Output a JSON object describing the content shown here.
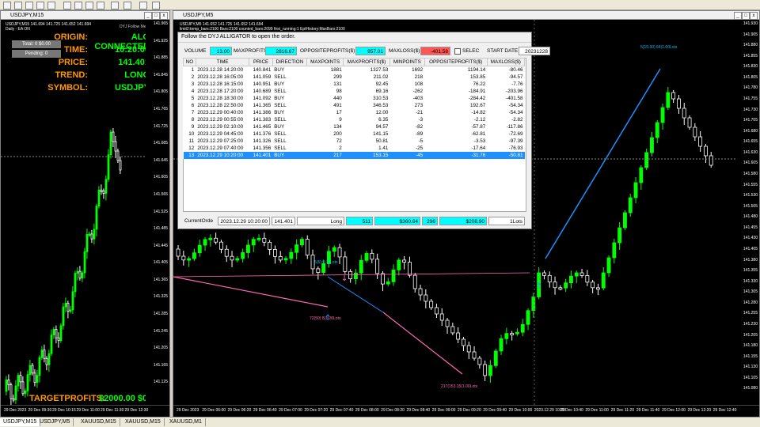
{
  "left_chart": {
    "title": "USDJPY,M15",
    "header_line": "USDJPY,M15  141.694 141.725 141.652 141.694",
    "ea_label": "DYJ Follow Me",
    "mode_label": "Daily - EA ON",
    "total_label": "Total: 0 $0.00",
    "pending_label": "Pending: 0",
    "info": {
      "origin_key": "ORIGIN:",
      "origin_val": "ALG CONNECTED",
      "time_key": "TIME:",
      "time_val": "10:20:00",
      "price_key": "PRICE:",
      "price_val": "141.401",
      "trend_key": "TREND:",
      "trend_val": "LONG",
      "symbol_key": "SYMBOL:",
      "symbol_val": "USDJPY"
    },
    "target_key": "TARGETPROFITS:",
    "target_val": "$2000.00 $0.00",
    "price_labels": [
      "141.965",
      "141.925",
      "141.885",
      "141.845",
      "141.805",
      "141.765",
      "141.725",
      "141.685",
      "141.645",
      "141.605",
      "141.565",
      "141.525",
      "141.485",
      "141.445",
      "141.405",
      "141.365",
      "141.325",
      "141.285",
      "141.245",
      "141.205",
      "141.165",
      "141.125"
    ],
    "current_price": "141.694",
    "time_labels": [
      "29 Dec 2023",
      "29 Dec 09:30",
      "29 Dec 10:15",
      "29 Dec 11:00",
      "29 Dec 11:30",
      "29 Dec 12:30"
    ]
  },
  "main_chart": {
    "title": "USDJPY,M5",
    "header_line": "USDJPY,M5  141.652 141.725 141.652 141.694",
    "sub_header": "limit2:temp_bars:2100 Bars:2100 counted_bars:2099 first_running:1 EptHistory:MaxBars:2100",
    "price_labels": [
      "141.930",
      "141.905",
      "141.880",
      "141.855",
      "141.830",
      "141.805",
      "141.780",
      "141.755",
      "141.730",
      "141.705",
      "141.680",
      "141.655",
      "141.630",
      "141.605",
      "141.580",
      "141.555",
      "141.530",
      "141.505",
      "141.480",
      "141.455",
      "141.430",
      "141.405",
      "141.380",
      "141.355",
      "141.330",
      "141.305",
      "141.280",
      "141.255",
      "141.230",
      "141.205",
      "141.180",
      "141.155",
      "141.130",
      "141.105",
      "141.080"
    ],
    "current_price": "141.694",
    "time_labels": [
      "29 Dec 2023",
      "29 Dec 06:00",
      "29 Dec 06:20",
      "29 Dec 06:40",
      "29 Dec 07:00",
      "29 Dec 07:20",
      "29 Dec 07:40",
      "29 Dec 08:00",
      "29 Dec 08:20",
      "29 Dec 08:40",
      "29 Dec 09:00",
      "29 Dec 09:20",
      "29 Dec 09:40",
      "29 Dec 10:00",
      "2023.12.29 10:20",
      "29 Dec 10:40",
      "29 Dec 11:00",
      "29 Dec 11:20",
      "29 Dec 11:40",
      "29 Dec 12:00",
      "29 Dec 12:20",
      "29 Dec 12:40"
    ],
    "annotations": {
      "top": "5(15:30) 64(1.00Lots",
      "mid": "5(5):9.00Lots",
      "left": "72(50) 8(1.00Lots",
      "bottom": "217(153.15(1.00Lots"
    }
  },
  "dialog": {
    "title": "Follow the DYJ ALLIGATOR to open the order.",
    "top": {
      "volume_label": "VOLUME",
      "volume_val": "13.00",
      "maxprofits_label": "MAXPROFITS",
      "maxprofits_val": "2816.67",
      "opposite_label": "OPPOSITEPROFITS($)",
      "opposite_val": "957.01",
      "maxloss_label": "MAXLOSS($)",
      "maxloss_val": "-401.58",
      "select_label": "SELEC",
      "startdate_label": "START DATE",
      "startdate_val": "20231228"
    },
    "columns": [
      "NO",
      "TIME",
      "PRICE",
      "DIRECTION",
      "MAXPOINTS",
      "MAXPROFITS($)",
      "MINPOINTS",
      "OPPOSITEPROFITS($)",
      "MAXLOSS($)"
    ],
    "rows": [
      [
        "1",
        "2023.12.28 14:20:00",
        "140.841",
        "BUY",
        "1881",
        "1327.53",
        "1692",
        "1194.14",
        "-80.46"
      ],
      [
        "2",
        "2023.12.28 16:05:00",
        "141.059",
        "SELL",
        "299",
        "211.02",
        "218",
        "153.85",
        "-94.57"
      ],
      [
        "3",
        "2023.12.28 16:15:00",
        "140.951",
        "BUY",
        "131",
        "92.45",
        "108",
        "76.22",
        "-7.76"
      ],
      [
        "4",
        "2023.12.28 17:20:00",
        "140.689",
        "SELL",
        "98",
        "69.16",
        "-262",
        "-184.91",
        "-203.96"
      ],
      [
        "5",
        "2023.12.28 18:30:00",
        "141.092",
        "BUY",
        "440",
        "310.53",
        "-403",
        "-284.42",
        "-401.58"
      ],
      [
        "6",
        "2023.12.28 22:50:00",
        "141.365",
        "SELL",
        "491",
        "346.53",
        "273",
        "192.67",
        "-54.34"
      ],
      [
        "7",
        "2023.12.29 00:40:00",
        "141.386",
        "BUY",
        "17",
        "12.00",
        "-21",
        "-14.82",
        "-54.34"
      ],
      [
        "8",
        "2023.12.29 00:55:00",
        "141.383",
        "SELL",
        "9",
        "6.35",
        "-3",
        "-2.12",
        "-2.82"
      ],
      [
        "9",
        "2023.12.29 02:10:00",
        "141.465",
        "BUY",
        "134",
        "94.57",
        "-82",
        "-57.87",
        "-117.86"
      ],
      [
        "10",
        "2023.12.29 04:45:00",
        "141.376",
        "SELL",
        "200",
        "141.15",
        "-89",
        "-62.81",
        "-72.69"
      ],
      [
        "11",
        "2023.12.29 07:25:00",
        "141.326",
        "SELL",
        "72",
        "50.81",
        "-5",
        "-3.53",
        "-97.39"
      ],
      [
        "12",
        "2023.12.29 07:40:00",
        "141.356",
        "SELL",
        "2",
        "1.41",
        "-25",
        "-17.64",
        "-76.93"
      ],
      [
        "13",
        "2023.12.29 10:20:00",
        "141.401",
        "BUY",
        "217",
        "153.15",
        "-45",
        "-31.76",
        "-50.81"
      ]
    ],
    "selected_row": 13,
    "bottom": {
      "label": "CurrentOrde",
      "time": "2023.12.29 10:20:00",
      "price": "141.401",
      "direction": "Long",
      "maxpoints": "511",
      "maxprofits": "$360.64",
      "minpoints": "296",
      "opposite": "$208.90",
      "lots": "1Lots"
    }
  },
  "tabs": [
    "USDJPY,M15",
    "USDJPY,M5",
    "XAUUSD,M15",
    "XAUUSD,M15",
    "XAUUSD,M1"
  ],
  "active_tab": 0,
  "colors": {
    "bull": "#00ff00",
    "bear": "#ffffff",
    "trend_blue": "#1e90ff",
    "trend_pink": "#ff69b4",
    "info_key": "#ff9900",
    "info_val": "#00ff00",
    "cyan": "#00ffff",
    "red": "#ff5555",
    "select": "#1e90ff"
  }
}
